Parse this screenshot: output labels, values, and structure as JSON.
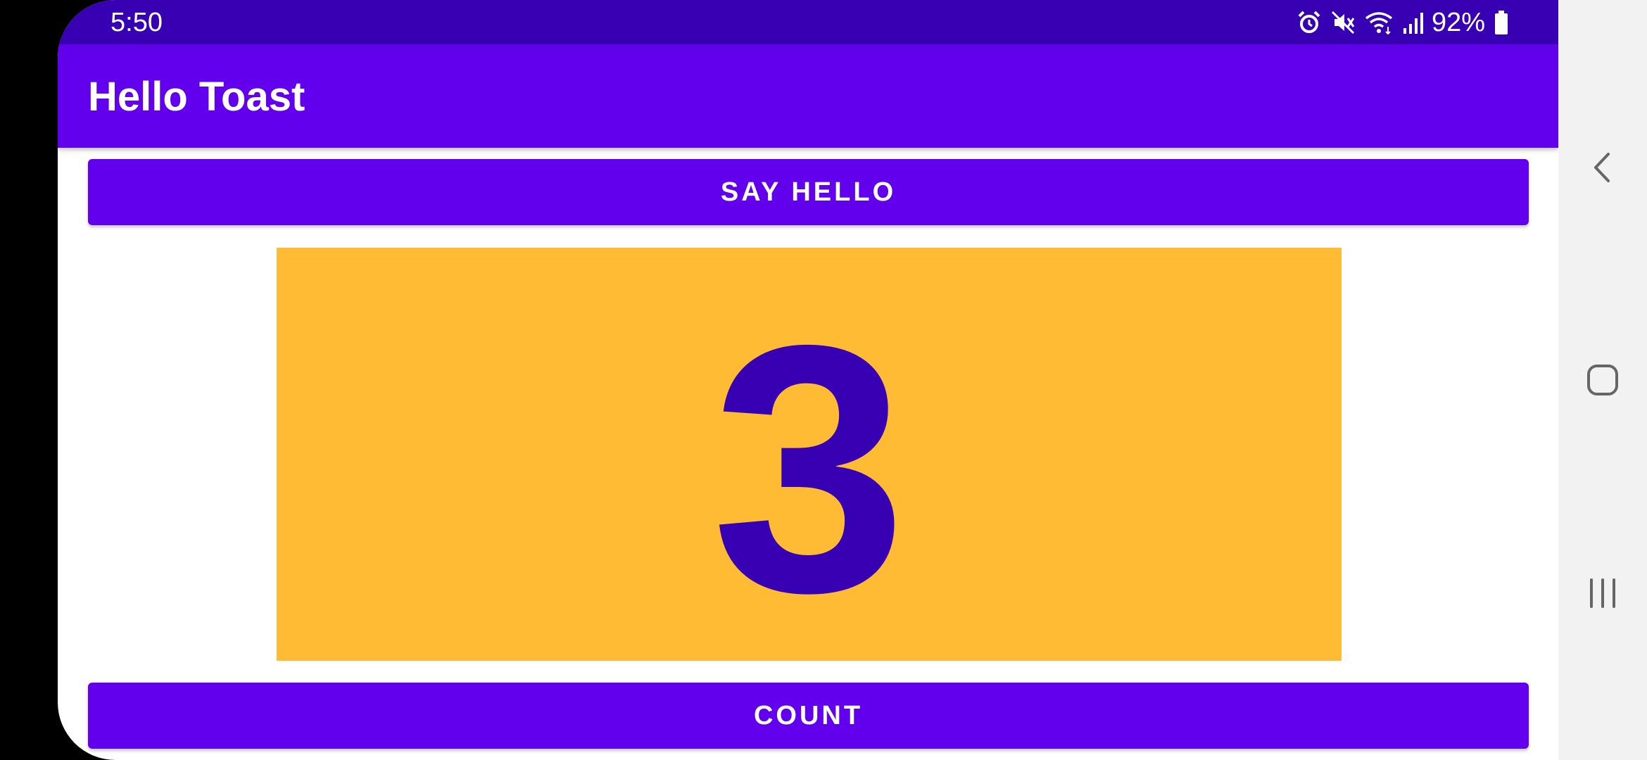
{
  "status_bar": {
    "time": "5:50",
    "battery_percent": "92%",
    "icons": [
      "alarm-icon",
      "mute-icon",
      "wifi-icon",
      "signal-icon",
      "battery-icon"
    ],
    "background_color": "#3700b3"
  },
  "app_bar": {
    "title": "Hello Toast",
    "background_color": "#6200ee"
  },
  "main": {
    "say_hello_label": "SAY HELLO",
    "count_value": "3",
    "count_label": "COUNT",
    "count_box_color": "#ffbb33",
    "count_text_color": "#3700b3",
    "button_color": "#6200ee"
  },
  "nav_bar": {
    "buttons": [
      "back-icon",
      "home-icon",
      "recents-icon"
    ]
  }
}
